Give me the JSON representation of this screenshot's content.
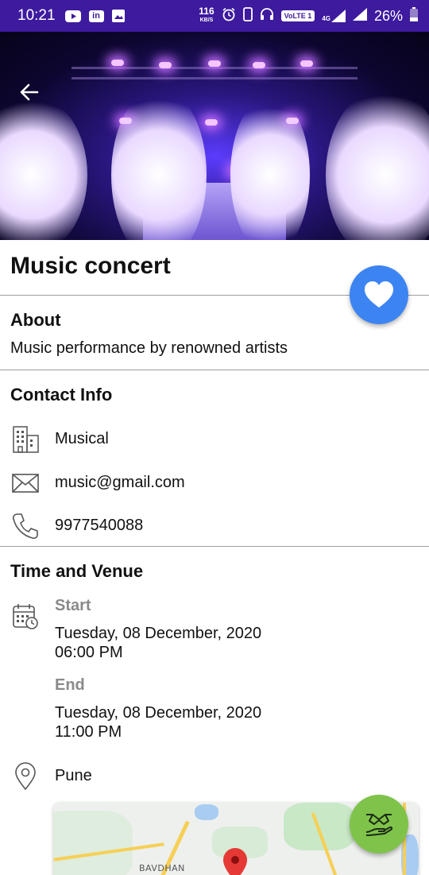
{
  "status_bar": {
    "time": "10:21",
    "speed_value": "116",
    "speed_unit": "KB/S",
    "volte": "VoLTE 1",
    "network": "4G",
    "battery": "26%"
  },
  "event": {
    "title": "Music concert"
  },
  "about": {
    "heading": "About",
    "description": "Music performance by renowned artists"
  },
  "contact": {
    "heading": "Contact Info",
    "organizer": "Musical",
    "email": "music@gmail.com",
    "phone": "9977540088"
  },
  "time_venue": {
    "heading": "Time and Venue",
    "start_label": "Start",
    "start_date": "Tuesday, 08 December, 2020",
    "start_time": "06:00 PM",
    "end_label": "End",
    "end_date": "Tuesday, 08 December, 2020",
    "end_time": "11:00 PM",
    "location": "Pune",
    "map_label": "BAVDHAN"
  },
  "colors": {
    "status_bar": "#3d1a9e",
    "favorite_fab": "#3d84f3",
    "deal_fab": "#7fc34a",
    "muted_text": "#8a8a8a"
  },
  "icons": {
    "back": "arrow-left-icon",
    "favorite": "heart-icon",
    "organizer": "building-icon",
    "email": "envelope-icon",
    "phone": "phone-icon",
    "calendar": "calendar-clock-icon",
    "location": "location-pin-icon",
    "deal": "handshake-icon"
  }
}
